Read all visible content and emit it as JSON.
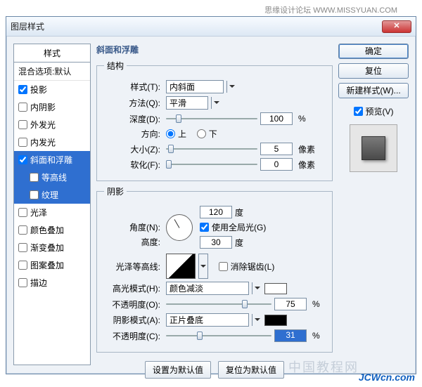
{
  "watermarks": {
    "top": "思缘设计论坛  WWW.MISSYUAN.COM",
    "bottom_logo": "JCWcn.com",
    "bottom_cn": "中国教程网"
  },
  "dialog": {
    "title": "图层样式",
    "left": {
      "header": "样式",
      "mix": "混合选项:默认",
      "items": [
        {
          "label": "投影",
          "checked": true,
          "selected": false
        },
        {
          "label": "内阴影",
          "checked": false,
          "selected": false
        },
        {
          "label": "外发光",
          "checked": false,
          "selected": false
        },
        {
          "label": "内发光",
          "checked": false,
          "selected": false
        },
        {
          "label": "斜面和浮雕",
          "checked": true,
          "selected": true
        },
        {
          "label": "等高线",
          "checked": false,
          "selected": true,
          "sub": true
        },
        {
          "label": "纹理",
          "checked": false,
          "selected": true,
          "sub": true
        },
        {
          "label": "光泽",
          "checked": false,
          "selected": false
        },
        {
          "label": "颜色叠加",
          "checked": false,
          "selected": false
        },
        {
          "label": "渐变叠加",
          "checked": false,
          "selected": false
        },
        {
          "label": "图案叠加",
          "checked": false,
          "selected": false
        },
        {
          "label": "描边",
          "checked": false,
          "selected": false
        }
      ]
    },
    "center": {
      "outer_title": "斜面和浮雕",
      "struct": {
        "legend": "结构",
        "style_label": "样式(T):",
        "style_value": "内斜面",
        "tech_label": "方法(Q):",
        "tech_value": "平滑",
        "depth_label": "深度(D):",
        "depth_value": "100",
        "pct": "%",
        "dir_label": "方向:",
        "dir_up": "上",
        "dir_down": "下",
        "size_label": "大小(Z):",
        "size_value": "5",
        "size_unit": "像素",
        "soft_label": "软化(F):",
        "soft_value": "0",
        "soft_unit": "像素"
      },
      "shade": {
        "legend": "阴影",
        "angle_label": "角度(N):",
        "angle_value": "120",
        "deg": "度",
        "global_label": "使用全局光(G)",
        "alt_label": "高度:",
        "alt_value": "30",
        "gloss_label": "光泽等高线:",
        "anti_label": "消除锯齿(L)",
        "hl_label": "高光模式(H):",
        "hl_value": "颜色减淡",
        "hl_op_label": "不透明度(O):",
        "hl_op_value": "75",
        "sh_label": "阴影模式(A):",
        "sh_value": "正片叠底",
        "sh_op_label": "不透明度(C):",
        "sh_op_value": "31"
      },
      "defaults": {
        "set": "设置为默认值",
        "reset": "复位为默认值"
      }
    },
    "right": {
      "ok": "确定",
      "reset": "复位",
      "new_style": "新建样式(W)...",
      "preview_label": "预览(V)"
    }
  }
}
